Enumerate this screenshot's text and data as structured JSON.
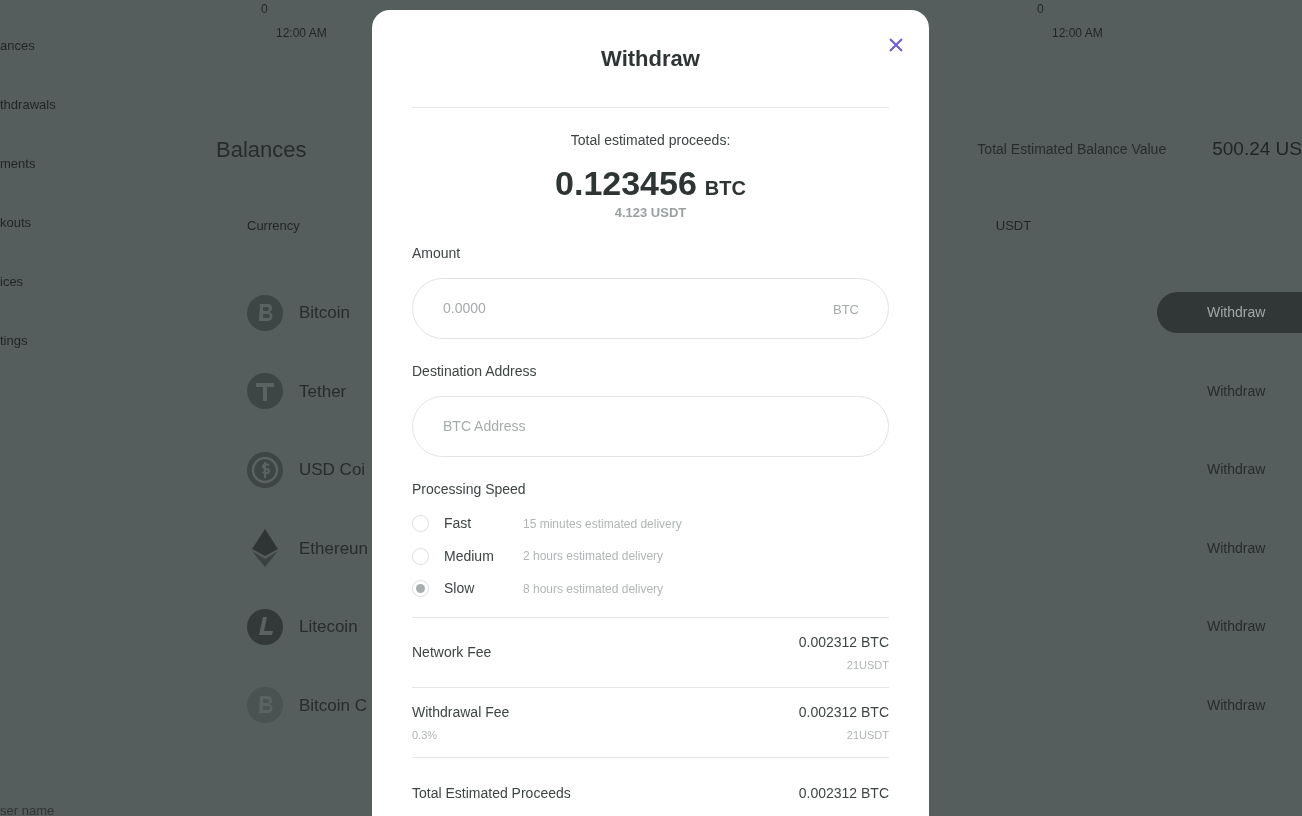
{
  "chart_axis": {
    "left": {
      "tick": "0",
      "time": "12:00 AM"
    },
    "right": {
      "tick": "0",
      "time": "12:00 AM"
    }
  },
  "sidebar": {
    "items": [
      {
        "label": "ances"
      },
      {
        "label": "thdrawals"
      },
      {
        "label": "ments"
      },
      {
        "label": "kouts"
      },
      {
        "label": "ices"
      },
      {
        "label": "tings"
      }
    ],
    "user": "ser name"
  },
  "balances": {
    "title": "Balances",
    "total_label": "Total Estimated Balance Value",
    "total_value": "500.24 US",
    "columns": [
      "Currency",
      "USDT"
    ],
    "rows": [
      {
        "kind": "btc",
        "name": "Bitcoin",
        "action": "Withdraw",
        "highlighted": true
      },
      {
        "kind": "usdt",
        "name": "Tether",
        "action": "Withdraw",
        "highlighted": false
      },
      {
        "kind": "usdc",
        "name": "USD Coi",
        "action": "Withdraw",
        "highlighted": false
      },
      {
        "kind": "eth",
        "name": "Ethereun",
        "action": "Withdraw",
        "highlighted": false
      },
      {
        "kind": "ltc",
        "name": "Litecoin",
        "action": "Withdraw",
        "highlighted": false
      },
      {
        "kind": "bch",
        "name": "Bitcoin C",
        "action": "Withdraw",
        "highlighted": false
      }
    ]
  },
  "modal": {
    "title": "Withdraw",
    "proceeds_label": "Total estimated proceeds:",
    "proceeds_amount": "0.123456",
    "proceeds_unit": "BTC",
    "proceeds_fiat": "4.123 USDT",
    "amount": {
      "label": "Amount",
      "placeholder": "0.0000",
      "suffix": "BTC"
    },
    "address": {
      "label": "Destination Address",
      "placeholder": "BTC Address"
    },
    "speed": {
      "label": "Processing Speed",
      "options": [
        {
          "name": "Fast",
          "note": "15 minutes estimated delivery",
          "selected": false
        },
        {
          "name": "Medium",
          "note": "2 hours estimated delivery",
          "selected": false
        },
        {
          "name": "Slow",
          "note": "8 hours estimated delivery",
          "selected": true
        }
      ]
    },
    "fees": [
      {
        "label": "Network Fee",
        "value": "0.002312 BTC",
        "fiat": "21USDT"
      },
      {
        "label": "Withdrawal Fee",
        "sub": "0.3%",
        "value": "0.002312 BTC",
        "fiat": "21USDT"
      },
      {
        "label": "Total Estimated Proceeds",
        "value": "0.002312 BTC"
      }
    ]
  }
}
